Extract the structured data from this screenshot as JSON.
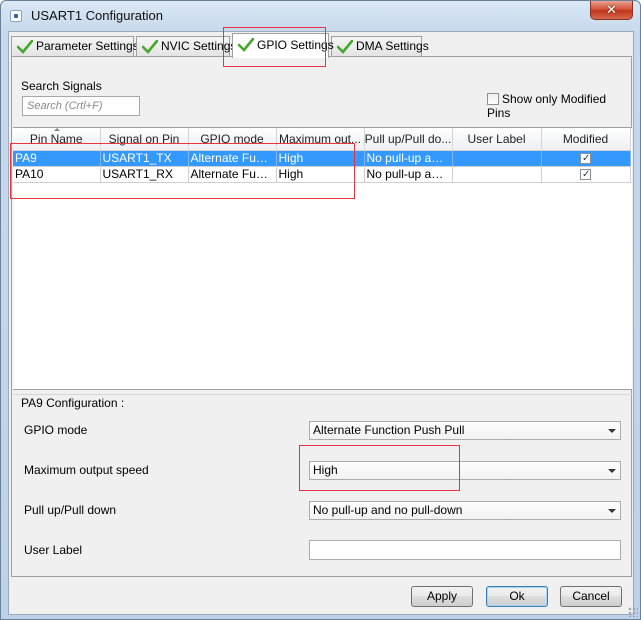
{
  "window": {
    "title": "USART1 Configuration",
    "close_glyph": "✕"
  },
  "tabs": [
    {
      "label": "Parameter Settings"
    },
    {
      "label": "NVIC Settings"
    },
    {
      "label": "GPIO Settings"
    },
    {
      "label": "DMA Settings"
    }
  ],
  "active_tab": "GPIO Settings",
  "search": {
    "label": "Search Signals",
    "placeholder": "Search (Crtl+F)"
  },
  "show_modified": {
    "label": "Show only Modified Pins",
    "checked": false
  },
  "table": {
    "columns": [
      "Pin Name",
      "Signal on Pin",
      "GPIO mode",
      "Maximum out...",
      "Pull up/Pull do...",
      "User Label",
      "Modified"
    ],
    "rows": [
      {
        "pin": "PA9",
        "signal": "USART1_TX",
        "mode": "Alternate Func...",
        "speed": "High",
        "pull": "No pull-up and ...",
        "label": "",
        "modified": true,
        "selected": true
      },
      {
        "pin": "PA10",
        "signal": "USART1_RX",
        "mode": "Alternate Func...",
        "speed": "High",
        "pull": "No pull-up and ...",
        "label": "",
        "modified": true,
        "selected": false
      }
    ]
  },
  "config": {
    "title": "PA9 Configuration :",
    "gpio_mode_label": "GPIO mode",
    "gpio_mode_value": "Alternate Function Push Pull",
    "speed_label": "Maximum output speed",
    "speed_value": "High",
    "pull_label": "Pull up/Pull down",
    "pull_value": "No pull-up and no pull-down",
    "user_label_label": "User Label",
    "user_label_value": ""
  },
  "buttons": {
    "apply": "Apply",
    "ok": "Ok",
    "cancel": "Cancel"
  },
  "colors": {
    "selection": "#3399ff",
    "annotation": "#e8343a",
    "check": "#43a82d"
  }
}
